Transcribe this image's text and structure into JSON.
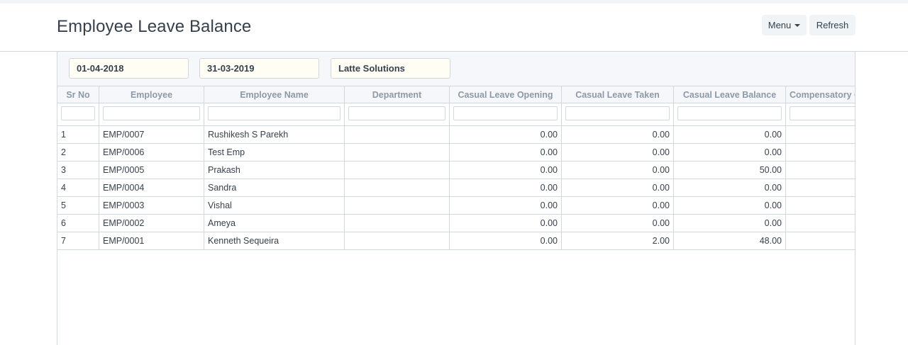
{
  "page": {
    "title": "Employee Leave Balance",
    "menu_label": "Menu",
    "refresh_label": "Refresh"
  },
  "filters": {
    "from_date": "01-04-2018",
    "to_date": "31-03-2019",
    "company": "Latte Solutions"
  },
  "table": {
    "columns": [
      {
        "key": "sr_no",
        "label": "Sr No"
      },
      {
        "key": "employee",
        "label": "Employee"
      },
      {
        "key": "employee_name",
        "label": "Employee Name"
      },
      {
        "key": "department",
        "label": "Department"
      },
      {
        "key": "cl_opening",
        "label": "Casual Leave Opening"
      },
      {
        "key": "cl_taken",
        "label": "Casual Leave Taken"
      },
      {
        "key": "cl_balance",
        "label": "Casual Leave Balance"
      },
      {
        "key": "comp_opening",
        "label": "Compensatory Off Opening"
      }
    ],
    "rows": [
      {
        "sr_no": "1",
        "employee": "EMP/0007",
        "employee_name": "Rushikesh S Parekh",
        "department": "",
        "cl_opening": "0.00",
        "cl_taken": "0.00",
        "cl_balance": "0.00",
        "comp_opening": ""
      },
      {
        "sr_no": "2",
        "employee": "EMP/0006",
        "employee_name": "Test Emp",
        "department": "",
        "cl_opening": "0.00",
        "cl_taken": "0.00",
        "cl_balance": "0.00",
        "comp_opening": ""
      },
      {
        "sr_no": "3",
        "employee": "EMP/0005",
        "employee_name": "Prakash",
        "department": "",
        "cl_opening": "0.00",
        "cl_taken": "0.00",
        "cl_balance": "50.00",
        "comp_opening": ""
      },
      {
        "sr_no": "4",
        "employee": "EMP/0004",
        "employee_name": "Sandra",
        "department": "",
        "cl_opening": "0.00",
        "cl_taken": "0.00",
        "cl_balance": "0.00",
        "comp_opening": ""
      },
      {
        "sr_no": "5",
        "employee": "EMP/0003",
        "employee_name": "Vishal",
        "department": "",
        "cl_opening": "0.00",
        "cl_taken": "0.00",
        "cl_balance": "0.00",
        "comp_opening": ""
      },
      {
        "sr_no": "6",
        "employee": "EMP/0002",
        "employee_name": "Ameya",
        "department": "",
        "cl_opening": "0.00",
        "cl_taken": "0.00",
        "cl_balance": "0.00",
        "comp_opening": ""
      },
      {
        "sr_no": "7",
        "employee": "EMP/0001",
        "employee_name": "Kenneth Sequeira",
        "department": "",
        "cl_opening": "0.00",
        "cl_taken": "2.00",
        "cl_balance": "48.00",
        "comp_opening": ""
      }
    ]
  }
}
